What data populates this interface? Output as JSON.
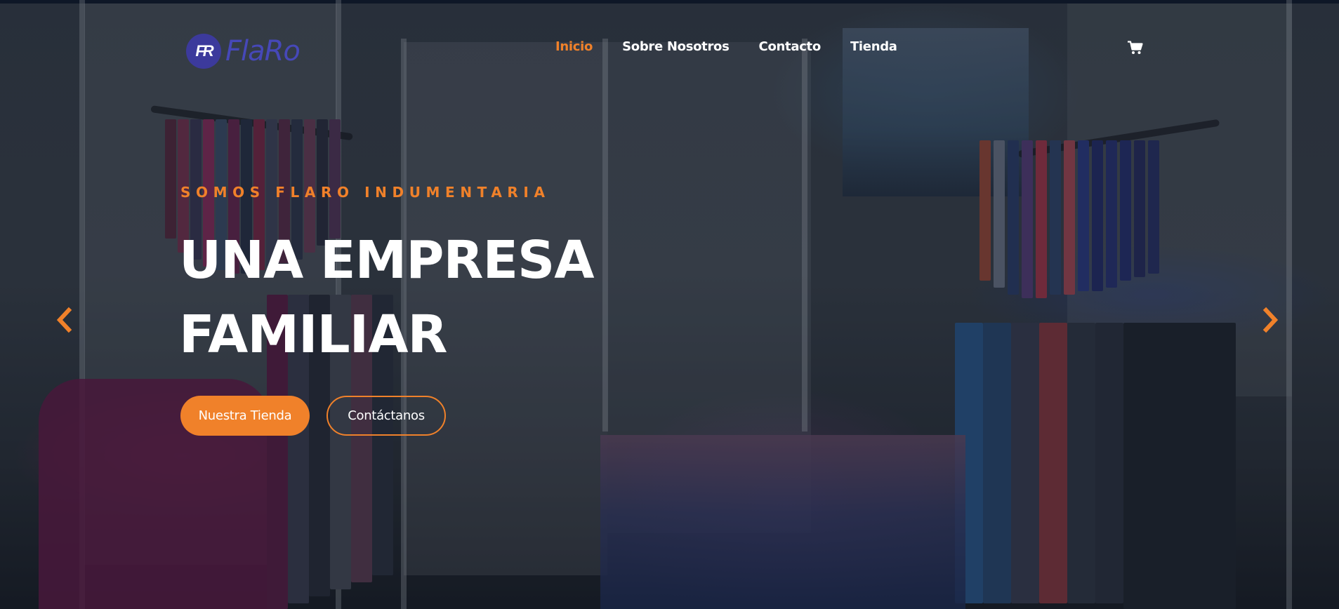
{
  "brand": {
    "logo_mark": "FR",
    "logo_text": "FlaRo",
    "accent_color": "#f0812a",
    "logo_color": "#4648b8"
  },
  "nav": {
    "items": [
      {
        "label": "Inicio",
        "active": true
      },
      {
        "label": "Sobre Nosotros",
        "active": false
      },
      {
        "label": "Contacto",
        "active": false
      },
      {
        "label": "Tienda",
        "active": false
      }
    ],
    "cart_icon": "shopping-cart-icon"
  },
  "hero": {
    "eyebrow": "SOMOS FLARO INDUMENTARIA",
    "headline_line1": "UNA EMPRESA",
    "headline_line2": "FAMILIAR",
    "primary_button": "Nuestra Tienda",
    "secondary_button": "Contáctanos"
  },
  "carousel": {
    "prev_icon": "chevron-left-icon",
    "next_icon": "chevron-right-icon"
  }
}
